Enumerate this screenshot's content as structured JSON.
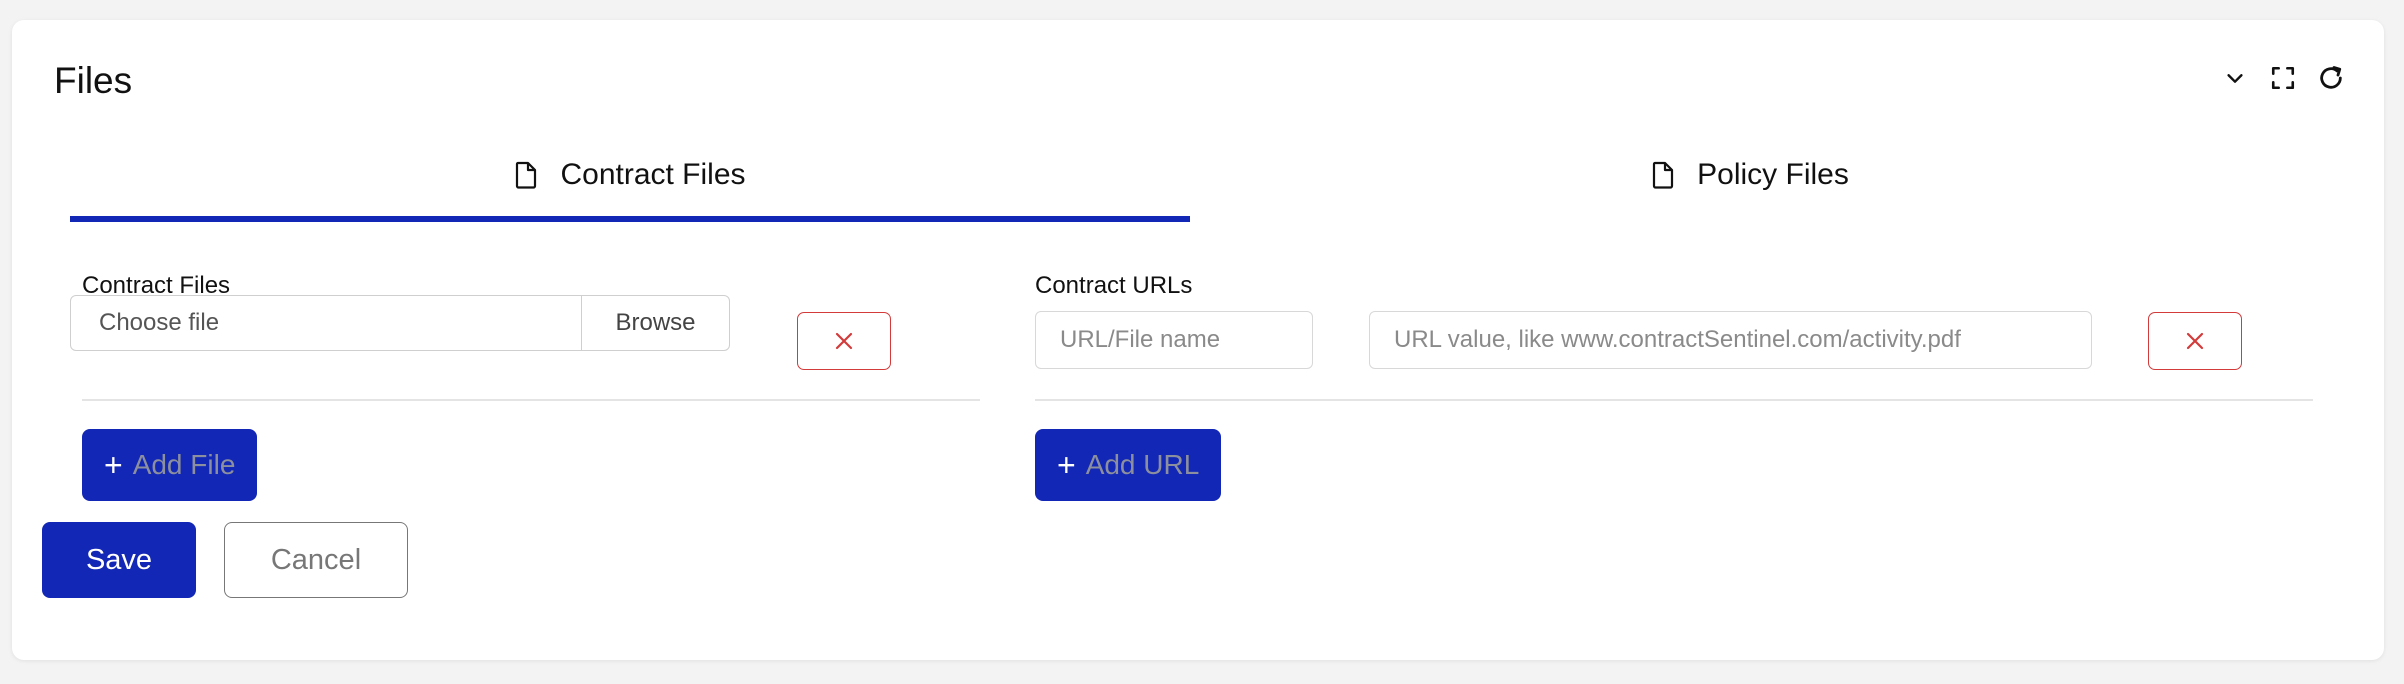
{
  "card": {
    "title": "Files"
  },
  "tabs": [
    {
      "label": "Contract Files",
      "active": true,
      "icon": "file-icon"
    },
    {
      "label": "Policy Files",
      "active": false,
      "icon": "file-icon"
    }
  ],
  "contract_files": {
    "label": "Contract Files",
    "choose_placeholder": "Choose file",
    "browse_label": "Browse",
    "add_label": "Add File"
  },
  "contract_urls": {
    "label": "Contract URLs",
    "name_placeholder": "URL/File name",
    "value_placeholder": "URL value, like www.contractSentinel.com/activity.pdf",
    "add_label": "Add URL"
  },
  "actions": {
    "save_label": "Save",
    "cancel_label": "Cancel"
  },
  "colors": {
    "primary": "#1227b5",
    "danger": "#d33a3a",
    "muted_text": "#8c8f9d"
  }
}
